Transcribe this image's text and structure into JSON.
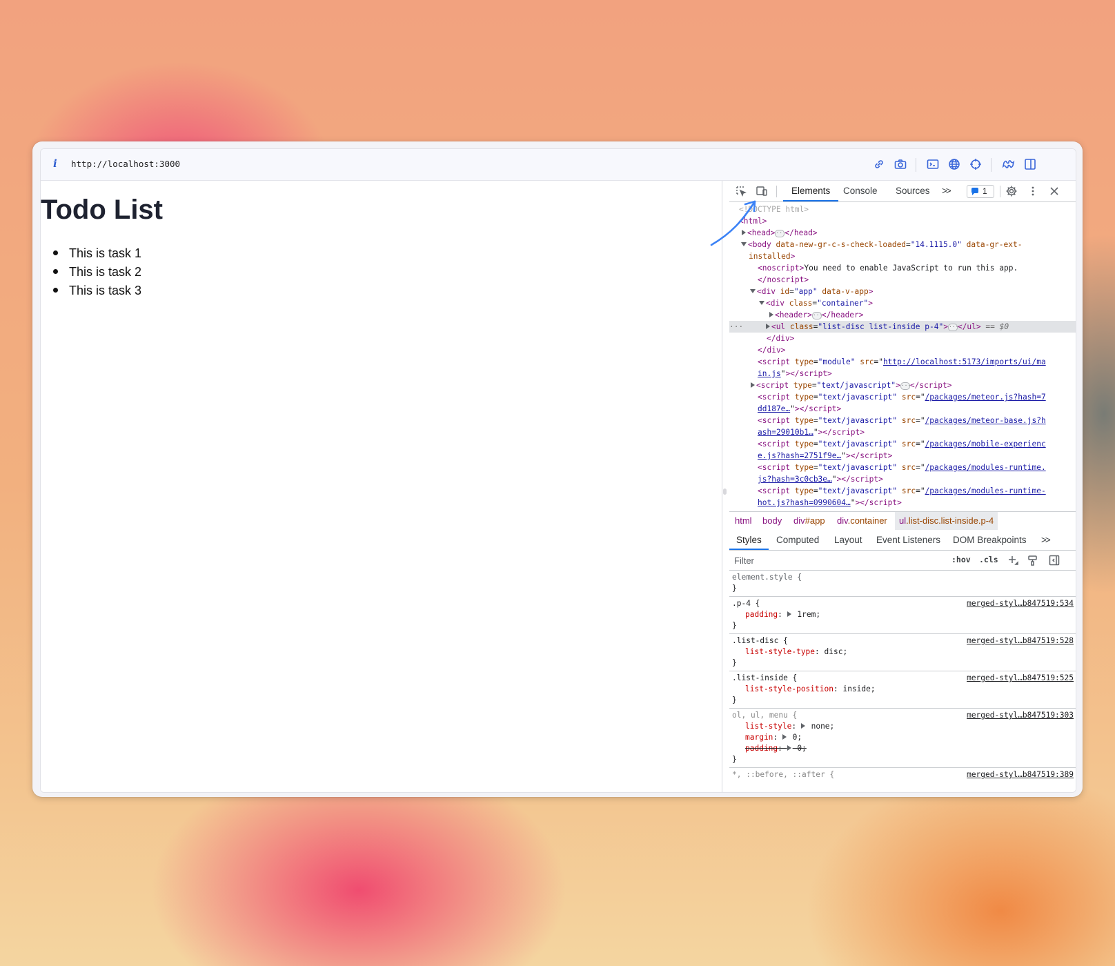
{
  "browser": {
    "url": "http://localhost:3000",
    "info_icon": "i",
    "toolbar_icons": [
      "link-icon",
      "camera-icon",
      "terminal-icon",
      "globe-icon",
      "crosshair-icon",
      "puzzle-icon",
      "split-panel-icon"
    ]
  },
  "page": {
    "title": "Todo List",
    "tasks": [
      "This is task 1",
      "This is task 2",
      "This is task 3"
    ]
  },
  "devtools": {
    "tabs": [
      "Elements",
      "Console",
      "Sources"
    ],
    "more_tabs": ">>",
    "issues_count": "1",
    "dom": {
      "doctype": "<!DOCTYPE html>",
      "html_open": "<html>",
      "head_open": "<head>",
      "head_close": "</head>",
      "body_tag": "body",
      "body_attr1": "data-new-gr-c-s-check-loaded",
      "body_val1": "\"14.1115.0\"",
      "body_attr2": "data-gr-ext-",
      "body_attr2b": "installed",
      "noscript_open": "<noscript>",
      "noscript_text": "You need to enable JavaScript to run this app.",
      "noscript_close": "</noscript>",
      "div_app_attr": "id",
      "div_app_val": "\"app\"",
      "div_app_attr2": "data-v-app",
      "div_container_attr": "class",
      "div_container_val": "\"container\"",
      "header_open": "<header>",
      "header_close": "</header>",
      "ul_attr": "class",
      "ul_val": "\"list-disc list-inside p-4\"",
      "ul_close": "</ul>",
      "dollar": "== $0",
      "div_close": "</div>",
      "script1_src": "http://localhost:5173/imports/ui/ma",
      "script1_src2": "in.js",
      "script_type_module": "\"module\"",
      "script_type_js": "\"text/javascript\"",
      "script3_src": "/packages/meteor.js?hash=7",
      "script3_src2": "dd187e…",
      "script4_src": "/packages/meteor-base.js?h",
      "script4_src2": "ash=29010b1…",
      "script5_src": "/packages/mobile-experienc",
      "script5_src2": "e.js?hash=2751f9e…",
      "script6_src": "/packages/modules-runtime.",
      "script6_src2": "js?hash=3c0cb3e…",
      "script7_src": "/packages/modules-runtime-",
      "script7_src2": "hot.js?hash=0990604…"
    },
    "breadcrumbs": [
      {
        "tag": "html"
      },
      {
        "tag": "body"
      },
      {
        "tag": "div",
        "cls": "#app"
      },
      {
        "tag": "div",
        "cls": ".container"
      },
      {
        "tag": "ul",
        "cls": ".list-disc.list-inside.p-4"
      }
    ],
    "style_tabs": [
      "Styles",
      "Computed",
      "Layout",
      "Event Listeners",
      "DOM Breakpoints"
    ],
    "filter_placeholder": "Filter",
    "hov": ":hov",
    "cls": ".cls",
    "rules": [
      {
        "selector": "element.style {",
        "source": "",
        "props": []
      },
      {
        "selector": ".p-4 {",
        "source": "merged-styl…b847519:534",
        "props": [
          {
            "name": "padding",
            "value": "1rem;"
          }
        ]
      },
      {
        "selector": ".list-disc {",
        "source": "merged-styl…b847519:528",
        "props": [
          {
            "name": "list-style-type",
            "value": "disc;"
          }
        ]
      },
      {
        "selector": ".list-inside {",
        "source": "merged-styl…b847519:525",
        "props": [
          {
            "name": "list-style-position",
            "value": "inside;"
          }
        ]
      },
      {
        "selector": "ol, ul, menu {",
        "source": "merged-styl…b847519:303",
        "props": [
          {
            "name": "list-style",
            "value": "none;"
          },
          {
            "name": "margin",
            "value": "0;"
          },
          {
            "name": "padding",
            "value": "0;"
          }
        ]
      },
      {
        "selector": "*, ::before, ::after {",
        "source": "merged-styl…b847519:389",
        "props": []
      }
    ],
    "close_brace": "}"
  },
  "colors": {
    "accent": "#1a73e8",
    "tag": "#881280",
    "attr": "#994500",
    "value": "#1a1aa6",
    "prop": "#c80000",
    "arrow": "#3b82f6"
  }
}
